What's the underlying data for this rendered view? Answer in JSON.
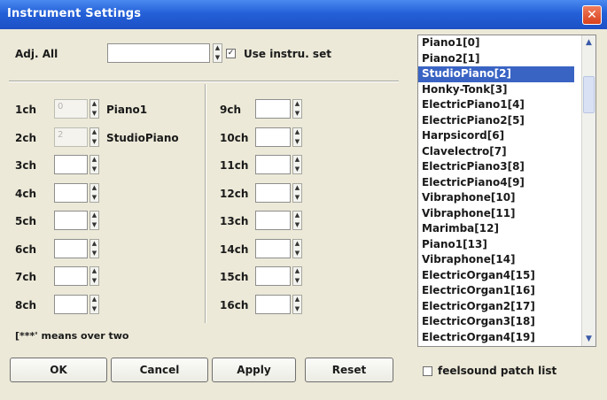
{
  "window": {
    "title": "Instrument Settings",
    "close_label": "✕"
  },
  "adj_all": {
    "label": "Adj. All",
    "value": ""
  },
  "use_instru": {
    "label": "Use instru. set",
    "checked": true,
    "mark": "✓"
  },
  "spinner": {
    "up": "▲",
    "down": "▼"
  },
  "channels": [
    {
      "label": "1ch",
      "value": "0",
      "instrument": "Piano1"
    },
    {
      "label": "2ch",
      "value": "2",
      "instrument": "StudioPiano"
    },
    {
      "label": "3ch",
      "value": "",
      "instrument": ""
    },
    {
      "label": "4ch",
      "value": "",
      "instrument": ""
    },
    {
      "label": "5ch",
      "value": "",
      "instrument": ""
    },
    {
      "label": "6ch",
      "value": "",
      "instrument": ""
    },
    {
      "label": "7ch",
      "value": "",
      "instrument": ""
    },
    {
      "label": "8ch",
      "value": "",
      "instrument": ""
    },
    {
      "label": "9ch",
      "value": "",
      "instrument": ""
    },
    {
      "label": "10ch",
      "value": "",
      "instrument": ""
    },
    {
      "label": "11ch",
      "value": "",
      "instrument": ""
    },
    {
      "label": "12ch",
      "value": "",
      "instrument": ""
    },
    {
      "label": "13ch",
      "value": "",
      "instrument": ""
    },
    {
      "label": "14ch",
      "value": "",
      "instrument": ""
    },
    {
      "label": "15ch",
      "value": "",
      "instrument": ""
    },
    {
      "label": "16ch",
      "value": "",
      "instrument": ""
    }
  ],
  "note": "[***' means over two",
  "buttons": {
    "ok": "OK",
    "cancel": "Cancel",
    "apply": "Apply",
    "reset": "Reset"
  },
  "instrument_list": {
    "items": [
      "Piano1[0]",
      "Piano2[1]",
      "StudioPiano[2]",
      "Honky-Tonk[3]",
      "ElectricPiano1[4]",
      "ElectricPiano2[5]",
      "Harpsicord[6]",
      "Clavelectro[7]",
      "ElectricPiano3[8]",
      "ElectricPiano4[9]",
      "Vibraphone[10]",
      "Vibraphone[11]",
      "Marimba[12]",
      "Piano1[13]",
      "Vibraphone[14]",
      "ElectricOrgan4[15]",
      "ElectricOrgan1[16]",
      "ElectricOrgan2[17]",
      "ElectricOrgan3[18]",
      "ElectricOrgan4[19]"
    ],
    "selected_index": 2,
    "scroll_up": "▲",
    "scroll_down": "▼"
  },
  "feelsound": {
    "label": "feelsound patch list",
    "checked": false
  }
}
